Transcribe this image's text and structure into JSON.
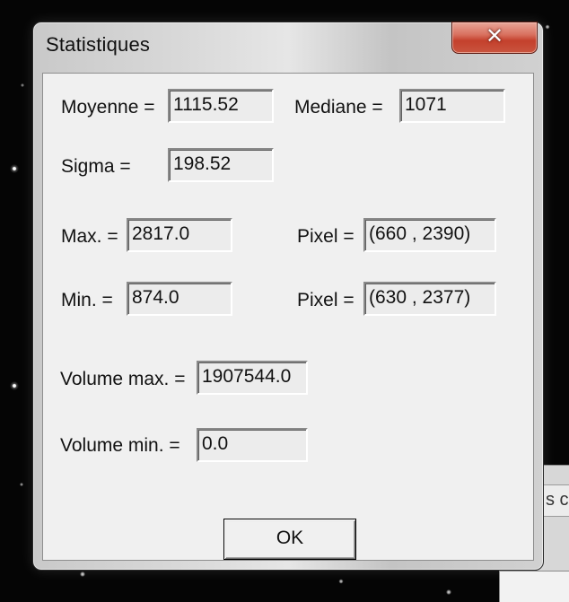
{
  "window": {
    "title": "Statistiques",
    "close_icon": "close-icon"
  },
  "stats": {
    "moyenne_label": "Moyenne =",
    "moyenne_value": "1115.52",
    "mediane_label": "Mediane =",
    "mediane_value": "1071",
    "sigma_label": "Sigma =",
    "sigma_value": "198.52",
    "max_label": "Max. =",
    "max_value": "2817.0",
    "max_pixel_label": "Pixel =",
    "max_pixel_value": "(660 , 2390)",
    "min_label": "Min. =",
    "min_value": "874.0",
    "min_pixel_label": "Pixel =",
    "min_pixel_value": "(630 , 2377)",
    "volume_max_label": "Volume max. =",
    "volume_max_value": "1907544.0",
    "volume_min_label": "Volume min. =",
    "volume_min_value": "0.0"
  },
  "buttons": {
    "ok_label": "OK",
    "close_glyph": "✕"
  },
  "background": {
    "window_tab_text": "s c"
  }
}
